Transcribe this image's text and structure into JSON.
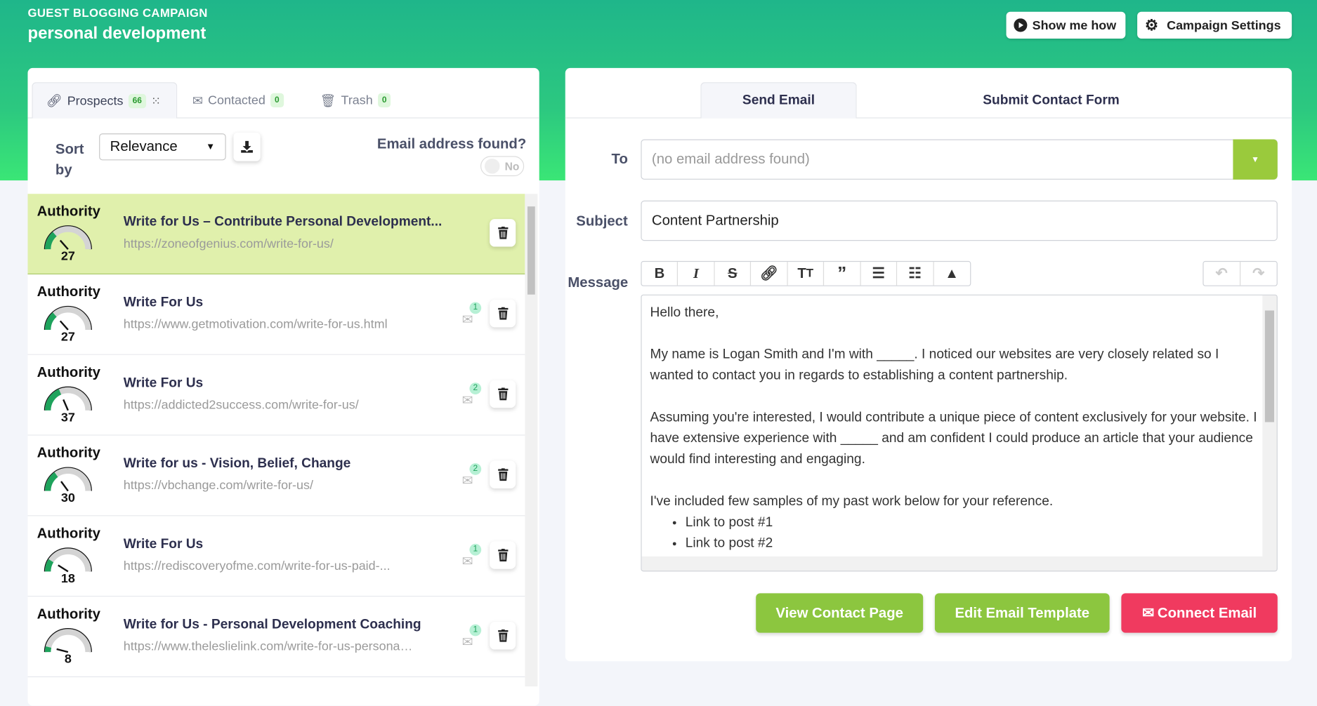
{
  "header": {
    "kicker": "GUEST BLOGGING CAMPAIGN",
    "title": "personal development",
    "show_me_how": "Show me how",
    "campaign_settings": "Campaign Settings"
  },
  "left": {
    "tabs": [
      {
        "label": "Prospects",
        "count": "66"
      },
      {
        "label": "Contacted",
        "count": "0"
      },
      {
        "label": "Trash",
        "count": "0"
      }
    ],
    "sort_label": "Sort by",
    "sort_value": "Relevance",
    "email_found_label": "Email address found?",
    "email_found_toggle": "No",
    "authority_label": "Authority",
    "rows": [
      {
        "authority": 27,
        "title": "Write for Us – Contribute Personal Development...",
        "url": "https://zoneofgenius.com/write-for-us/",
        "emails": null,
        "selected": true
      },
      {
        "authority": 27,
        "title": "Write For Us",
        "url": "https://www.getmotivation.com/write-for-us.html",
        "emails": "1"
      },
      {
        "authority": 37,
        "title": "Write For Us",
        "url": "https://addicted2success.com/write-for-us/",
        "emails": "2"
      },
      {
        "authority": 30,
        "title": "Write for us - Vision, Belief, Change",
        "url": "https://vbchange.com/write-for-us/",
        "emails": "2"
      },
      {
        "authority": 18,
        "title": "Write For Us",
        "url": "https://rediscoveryofme.com/write-for-us-paid-...",
        "emails": "1"
      },
      {
        "authority": 8,
        "title": "Write for Us - Personal Development Coaching",
        "url": "https://www.theleslielink.com/write-for-us-personal-...",
        "emails": "1"
      }
    ]
  },
  "right": {
    "tabs": [
      "Send Email",
      "Submit Contact Form"
    ],
    "to_label": "To",
    "to_placeholder": "(no email address found)",
    "subject_label": "Subject",
    "subject_value": "Content Partnership",
    "message_label": "Message",
    "message": {
      "p1": "Hello there,",
      "p2": "My name is Logan Smith and I'm with _____. I noticed our websites are very closely related so I wanted to contact you in regards to establishing a content partnership.",
      "p3": "Assuming you're interested, I would contribute a unique piece of content exclusively for your website. I have extensive experience with _____ and am confident I could produce an article that your audience would find interesting and engaging.",
      "p4": "I've included few samples of my past work below for your reference.",
      "items": [
        "Link to post #1",
        "Link to post #2"
      ]
    },
    "buttons": {
      "view_contact": "View Contact Page",
      "edit_template": "Edit Email Template",
      "connect_email": "Connect Email"
    }
  },
  "colors": {
    "green_btn": "#8cc63f",
    "red_btn": "#f03a5f",
    "selected_row": "#e0f0ac",
    "gauge_fill": "#1ea35c"
  }
}
